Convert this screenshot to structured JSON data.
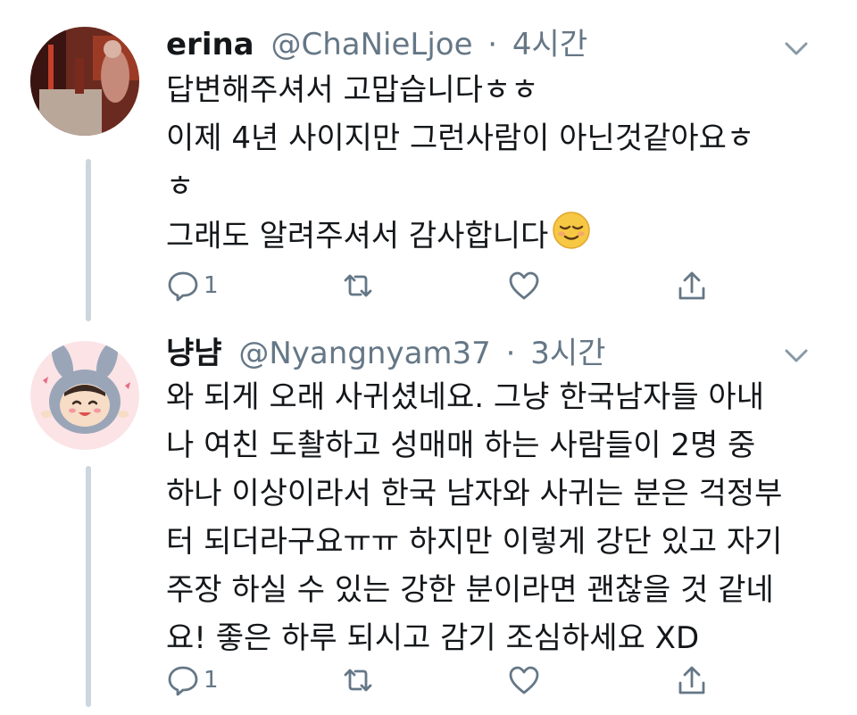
{
  "tweets": [
    {
      "display_name": "erina",
      "handle": "@ChaNieLjoe",
      "separator": "·",
      "time": "4시간",
      "lines": [
        "답변해주셔서 고맙습니다ㅎㅎ",
        "이제 4년 사이지만 그런사람이 아닌것같아요ㅎ",
        "ㅎ",
        "그래도 알려주셔서 감사합니다"
      ],
      "reply_count": "1",
      "avatar_icon": "profile-photo"
    },
    {
      "display_name": "냥냠",
      "handle": "@Nyangnyam37",
      "separator": "·",
      "time": "3시간",
      "lines": [
        "와 되게 오래 사귀셨네요. 그냥 한국남자들 아내",
        "나 여친 도촬하고 성매매 하는 사람들이 2명 중",
        "하나 이상이라서 한국 남자와 사귀는 분은 걱정부",
        "터 되더라구요ㅠㅠ 하지만 이렇게 강단 있고 자기",
        "주장 하실 수 있는 강한 분이라면 괜찮을 것 같네",
        "요! 좋은 하루 되시고 감기 조심하세요 XD"
      ],
      "reply_count": "1",
      "avatar_icon": "bunny-hood-cartoon"
    }
  ],
  "colors": {
    "text": "#14171a",
    "secondary": "#657786",
    "thread_line": "#ccd6dd",
    "icon": "#657786"
  }
}
